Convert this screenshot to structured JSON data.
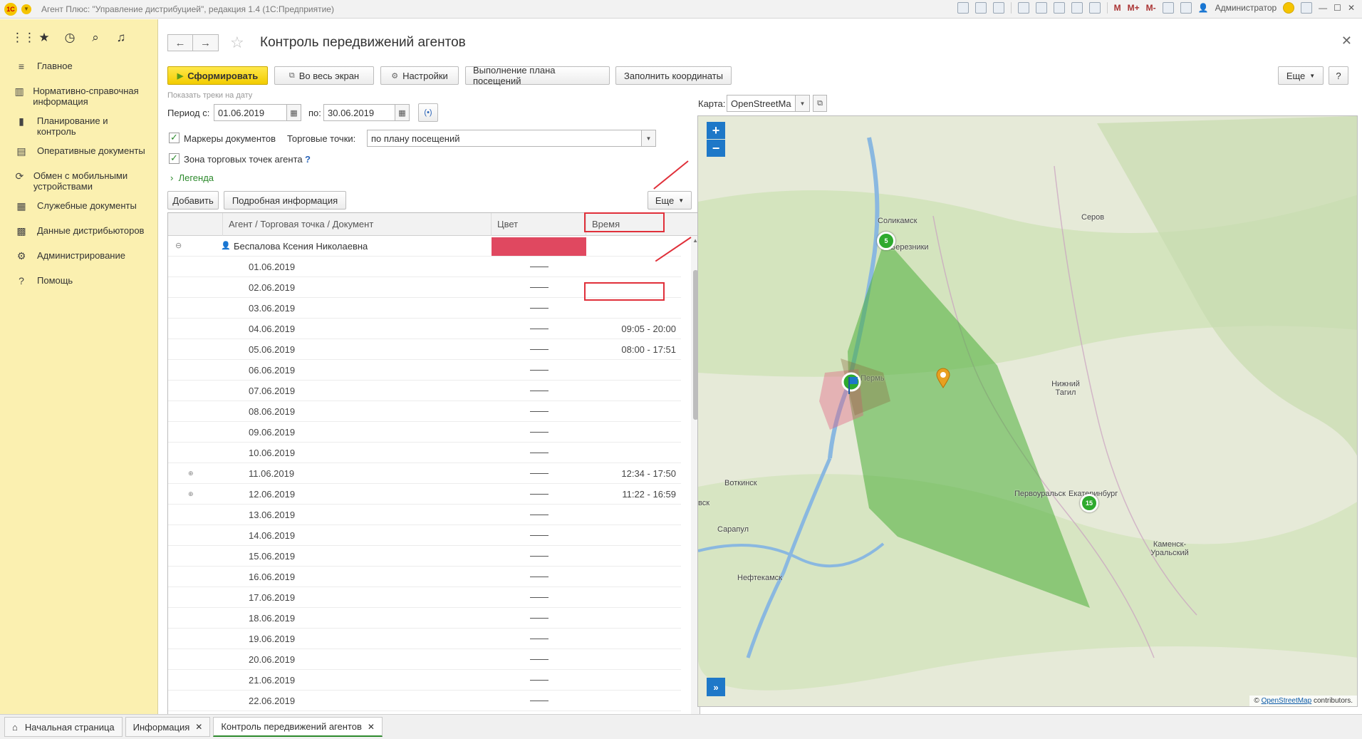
{
  "app": {
    "title": "Агент Плюс: \"Управление дистрибуцией\", редакция 1.4  (1С:Предприятие)",
    "logo_text": "1С",
    "user": "Администратор",
    "toolbar_letters": [
      "M",
      "M+",
      "M-"
    ]
  },
  "sidebar": {
    "items": [
      {
        "label": "Главное",
        "icon": "menu-icon"
      },
      {
        "label": "Нормативно-справочная информация",
        "icon": "reference-icon"
      },
      {
        "label": "Планирование и контроль",
        "icon": "chart-icon"
      },
      {
        "label": "Оперативные документы",
        "icon": "documents-icon"
      },
      {
        "label": "Обмен с мобильными устройствами",
        "icon": "sync-icon"
      },
      {
        "label": "Служебные документы",
        "icon": "service-docs-icon"
      },
      {
        "label": "Данные дистрибьюторов",
        "icon": "distributor-icon"
      },
      {
        "label": "Администрирование",
        "icon": "gear-icon"
      },
      {
        "label": "Помощь",
        "icon": "help-icon"
      }
    ]
  },
  "page": {
    "title": "Контроль передвижений агентов"
  },
  "toolbar": {
    "form_label": "Сформировать",
    "fullscreen_label": "Во весь экран",
    "settings_label": "Настройки",
    "plan_label": "Выполнение плана посещений",
    "coords_label": "Заполнить координаты",
    "more_label": "Еще"
  },
  "filters": {
    "tracks_hint": "Показать треки на дату",
    "period_from_label": "Период с:",
    "period_from": "01.06.2019",
    "period_to_label": "по:",
    "period_to": "30.06.2019",
    "doc_markers_label": "Маркеры документов",
    "outlets_label": "Торговые точки:",
    "outlets_value": "по плану посещений",
    "zone_label": "Зона торговых точек агента",
    "zone_help": "?",
    "legend_label": "Легенда",
    "map_label": "Карта:",
    "map_value": "OpenStreetMap"
  },
  "table_toolbar": {
    "add_label": "Добавить",
    "details_label": "Подробная информация",
    "more_label": "Еще"
  },
  "table": {
    "headers": [
      "Агент / Торговая точка / Документ",
      "Цвет",
      "Время"
    ],
    "agent": "Беспалова Ксения Николаевна",
    "rows": [
      {
        "date": "01.06.2019",
        "time": "",
        "expand": false
      },
      {
        "date": "02.06.2019",
        "time": "",
        "expand": false
      },
      {
        "date": "03.06.2019",
        "time": "",
        "expand": false
      },
      {
        "date": "04.06.2019",
        "time": "09:05 - 20:00",
        "expand": false
      },
      {
        "date": "05.06.2019",
        "time": "08:00 - 17:51",
        "expand": false
      },
      {
        "date": "06.06.2019",
        "time": "",
        "expand": false
      },
      {
        "date": "07.06.2019",
        "time": "",
        "expand": false
      },
      {
        "date": "08.06.2019",
        "time": "",
        "expand": false
      },
      {
        "date": "09.06.2019",
        "time": "",
        "expand": false
      },
      {
        "date": "10.06.2019",
        "time": "",
        "expand": false
      },
      {
        "date": "11.06.2019",
        "time": "12:34 - 17:50",
        "expand": true
      },
      {
        "date": "12.06.2019",
        "time": "11:22 - 16:59",
        "expand": true
      },
      {
        "date": "13.06.2019",
        "time": "",
        "expand": false
      },
      {
        "date": "14.06.2019",
        "time": "",
        "expand": false
      },
      {
        "date": "15.06.2019",
        "time": "",
        "expand": false
      },
      {
        "date": "16.06.2019",
        "time": "",
        "expand": false
      },
      {
        "date": "17.06.2019",
        "time": "",
        "expand": false
      },
      {
        "date": "18.06.2019",
        "time": "",
        "expand": false
      },
      {
        "date": "19.06.2019",
        "time": "",
        "expand": false
      },
      {
        "date": "20.06.2019",
        "time": "",
        "expand": false
      },
      {
        "date": "21.06.2019",
        "time": "",
        "expand": false
      },
      {
        "date": "22.06.2019",
        "time": "",
        "expand": false
      }
    ],
    "agent_color": "#e04860"
  },
  "map": {
    "cities": [
      {
        "name": "Соликамск"
      },
      {
        "name": "Березники"
      },
      {
        "name": "Серов"
      },
      {
        "name": "Нижний Тагил"
      },
      {
        "name": "Первоуральск"
      },
      {
        "name": "Екатеринбург"
      },
      {
        "name": "Воткинск"
      },
      {
        "name": "Сарапул"
      },
      {
        "name": "Нефтекамск"
      },
      {
        "name": "Каменск-Уральский"
      },
      {
        "name": "вск"
      },
      {
        "name": "Пермь"
      }
    ],
    "clusters": [
      "5",
      "15"
    ],
    "attribution_prefix": "©",
    "attribution_link": "OpenStreetMap",
    "attribution_suffix": "contributors."
  },
  "tabs": [
    {
      "label": "Начальная страница"
    },
    {
      "label": "Информация"
    },
    {
      "label": "Контроль передвижений агентов"
    }
  ],
  "colors": {
    "accent": "#2d8a2d",
    "primary_btn": "#f2cc00",
    "highlight": "#e0303a",
    "sidebar": "#fbf0b0"
  }
}
